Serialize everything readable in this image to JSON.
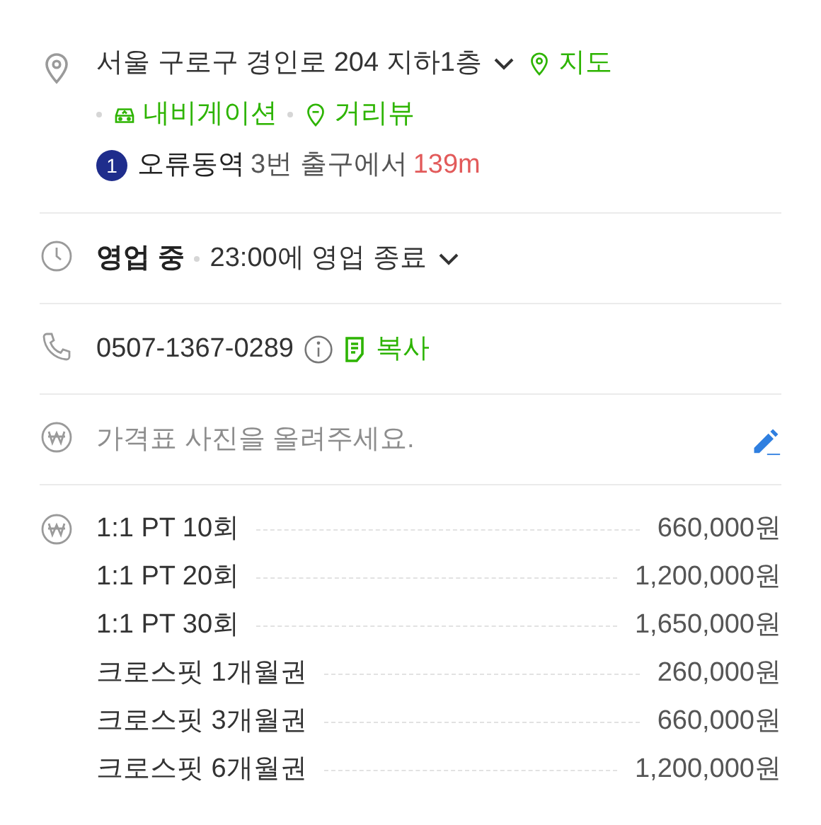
{
  "address": {
    "text": "서울 구로구 경인로 204 지하1층",
    "map_link": "지도"
  },
  "nav_links": [
    {
      "kind": "navigation",
      "label": "내비게이션"
    },
    {
      "kind": "streetview",
      "label": "거리뷰"
    }
  ],
  "transit": {
    "line": "1",
    "color": "#1f2d8c",
    "station": "오류동역",
    "exit": "3번 출구에서",
    "distance": "139m"
  },
  "hours": {
    "status": "영업 중",
    "detail": "23:00에 영업 종료"
  },
  "phone": {
    "number": "0507-1367-0289",
    "copy": "복사"
  },
  "price_photo": {
    "prompt": "가격표 사진을 올려주세요."
  },
  "prices": [
    {
      "name": "1:1 PT 10회",
      "price": "660,000원"
    },
    {
      "name": "1:1 PT 20회",
      "price": "1,200,000원"
    },
    {
      "name": "1:1 PT 30회",
      "price": "1,650,000원"
    },
    {
      "name": "크로스핏 1개월권",
      "price": "260,000원"
    },
    {
      "name": "크로스핏 3개월권",
      "price": "660,000원"
    },
    {
      "name": "크로스핏 6개월권",
      "price": "1,200,000원"
    }
  ]
}
